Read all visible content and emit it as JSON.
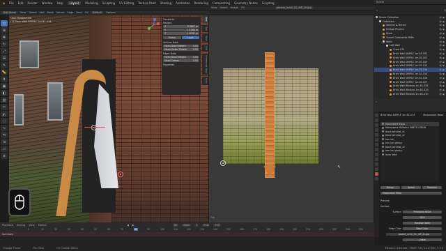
{
  "topbar": {
    "menus": [
      "File",
      "Edit",
      "Render",
      "Window",
      "Help"
    ],
    "workspaces": [
      "Layout",
      "Modeling",
      "Sculpting",
      "UV Editing",
      "Texture Paint",
      "Shading",
      "Animation",
      "Rendering",
      "Compositing",
      "Geometry Nodes",
      "Scripting"
    ],
    "active_workspace": "Layout",
    "scene": "Scene",
    "view_layer": "ViewLayer"
  },
  "viewport": {
    "mode": "Edit Mode",
    "view_label": "User Perspective",
    "object_label": "(1) Brick Wall SIMPLE 1m 81.014",
    "header_items": [
      "View",
      "Select",
      "Add",
      "Mesh",
      "Vertex",
      "Edge",
      "Face",
      "UV"
    ],
    "orientation": "Default",
    "options_label": "Options"
  },
  "npanel": {
    "title": "Transform",
    "median_label": "Median:",
    "fields": [
      {
        "axis": "X",
        "value": "0.3807 m"
      },
      {
        "axis": "Y",
        "value": "13.564 m"
      },
      {
        "axis": "Z",
        "value": "1.8797 m"
      }
    ],
    "global_label": "Global",
    "local_label": "Local",
    "vertices_data": "Vertices Data:",
    "vertex_fields": [
      {
        "label": "Mean Bevel Weight",
        "value": "0.00"
      },
      {
        "label": "Mean Vertex Crease",
        "value": "0.00"
      }
    ],
    "edges_data": "Edges Data:",
    "edge_fields": [
      {
        "label": "Mean Bevel Weight",
        "value": "0.00"
      },
      {
        "label": "Mean Crease",
        "value": "0.00"
      }
    ],
    "properties_label": "Properties",
    "tabs": [
      "Item",
      "Tool",
      "View",
      "Edit",
      "Screencast Keys",
      "Sync"
    ]
  },
  "uv_editor": {
    "header_items": [
      "View",
      "Select",
      "Image",
      "UV"
    ],
    "image_name": "plaster_brick_01_diff_2k.jpg",
    "footer": "Tile"
  },
  "outliner": {
    "header": "Scene",
    "rows": [
      {
        "label": "Scene Collection",
        "indent": 0,
        "highlight": false,
        "color": "#ccc"
      },
      {
        "label": "Collection",
        "indent": 1,
        "highlight": false,
        "color": "#ddd"
      },
      {
        "label": "Volume & Terrain",
        "indent": 2,
        "highlight": false,
        "color": "#c9a35a"
      },
      {
        "label": "Foliage Physics",
        "indent": 2,
        "highlight": false,
        "color": "#c9a35a"
      },
      {
        "label": "Stock",
        "indent": 2,
        "highlight": false,
        "color": "#c9a35a"
      },
      {
        "label": "Tunnel Outerwalls PBRs",
        "indent": 2,
        "highlight": false,
        "color": "#c9a35a"
      },
      {
        "label": "Walls",
        "indent": 2,
        "highlight": false,
        "color": "#ddd"
      },
      {
        "label": "Left Wall",
        "indent": 3,
        "highlight": false,
        "color": "#ddd"
      },
      {
        "label": "Cube 074",
        "indent": 4,
        "highlight": false,
        "color": "#e69a48"
      },
      {
        "label": "Brick Wall SIMPLE 1m 81.002",
        "indent": 4,
        "highlight": false,
        "color": "#e69a48"
      },
      {
        "label": "Brick Wall SIMPLE 1m 81.003",
        "indent": 4,
        "highlight": false,
        "color": "#e69a48"
      },
      {
        "label": "Brick Wall SIMPLE 1m 81.004",
        "indent": 4,
        "highlight": false,
        "color": "#e69a48"
      },
      {
        "label": "Brick Wall SIMPLE 1m 81.013",
        "indent": 4,
        "highlight": false,
        "color": "#e69a48"
      },
      {
        "label": "Brick Wall SIMPLE 1m 81.014",
        "indent": 4,
        "highlight": true,
        "color": "#e69a48"
      },
      {
        "label": "Brick Wall SIMPLE 1m 81.015",
        "indent": 4,
        "highlight": false,
        "color": "#e69a48"
      },
      {
        "label": "Brick Wall SIMPLE 1m 81.016",
        "indent": 4,
        "highlight": false,
        "color": "#e69a48"
      },
      {
        "label": "Brick Wall SIMPLE 1m 81.027",
        "indent": 4,
        "highlight": false,
        "color": "#e69a48"
      },
      {
        "label": "Brick Wall Window 1m 81.028",
        "indent": 4,
        "highlight": false,
        "color": "#e69a48"
      },
      {
        "label": "Brick Wall Window 1m 81.029",
        "indent": 4,
        "highlight": false,
        "color": "#e69a48"
      },
      {
        "label": "Brick Wall Window 1m 81.030",
        "indent": 4,
        "highlight": false,
        "color": "#e69a48"
      }
    ]
  },
  "properties": {
    "object_name": "Brick Wall SIMPLE 1m 81.014",
    "material_tab": "Masonwork Moss",
    "materials": [
      {
        "name": "Masonwork Moss",
        "selected": true
      },
      {
        "name": "Masonwork Dirtbrick 58675 LOBUN",
        "selected": false
      },
      {
        "name": "black window_x1",
        "selected": false
      },
      {
        "name": "black window_x2",
        "selected": false
      },
      {
        "name": "Iron Ion",
        "selected": false
      },
      {
        "name": "Iron Ion glossy",
        "selected": false
      },
      {
        "name": "black window_x2",
        "selected": false
      },
      {
        "name": "Iron Ion glossy",
        "selected": false
      },
      {
        "name": "inner Wall",
        "selected": false
      }
    ],
    "assign": "Assign",
    "select": "Select",
    "deselect": "Deselect",
    "material_slot": "Masonwork Moss",
    "preview_label": "Preview",
    "surface_section": "Surface",
    "surface_label": "Surface",
    "surface_value": "Principled BSDF",
    "ggx": "GGX",
    "random_walk": "Random Walk",
    "base_color_label": "Base Color",
    "base_color_value": "Base Color",
    "texture_value": "plaster_brick_01_diff_2k.jpg",
    "linear": "Linear"
  },
  "timeline": {
    "header_items": [
      "Playback",
      "Keying",
      "View",
      "Marker"
    ],
    "current_frame": "80",
    "start_label": "Start",
    "start_value": "1",
    "end_label": "End",
    "end_value": "250",
    "ticks": [
      "0",
      "10",
      "20",
      "30",
      "40",
      "50",
      "60",
      "70",
      "80",
      "90",
      "100",
      "110",
      "120",
      "130",
      "140",
      "150",
      "160",
      "170",
      "180",
      "190",
      "200",
      "210",
      "220",
      "230",
      "240",
      "250"
    ],
    "summary": "Summary"
  },
  "statusbar": {
    "items": [
      "Change Frame",
      "Pan View",
      "UV Context Menu"
    ],
    "stats": "Memory: 3.88 GiB | VRAM: 3.6 / 12.0 GiB | 3.3.0"
  }
}
